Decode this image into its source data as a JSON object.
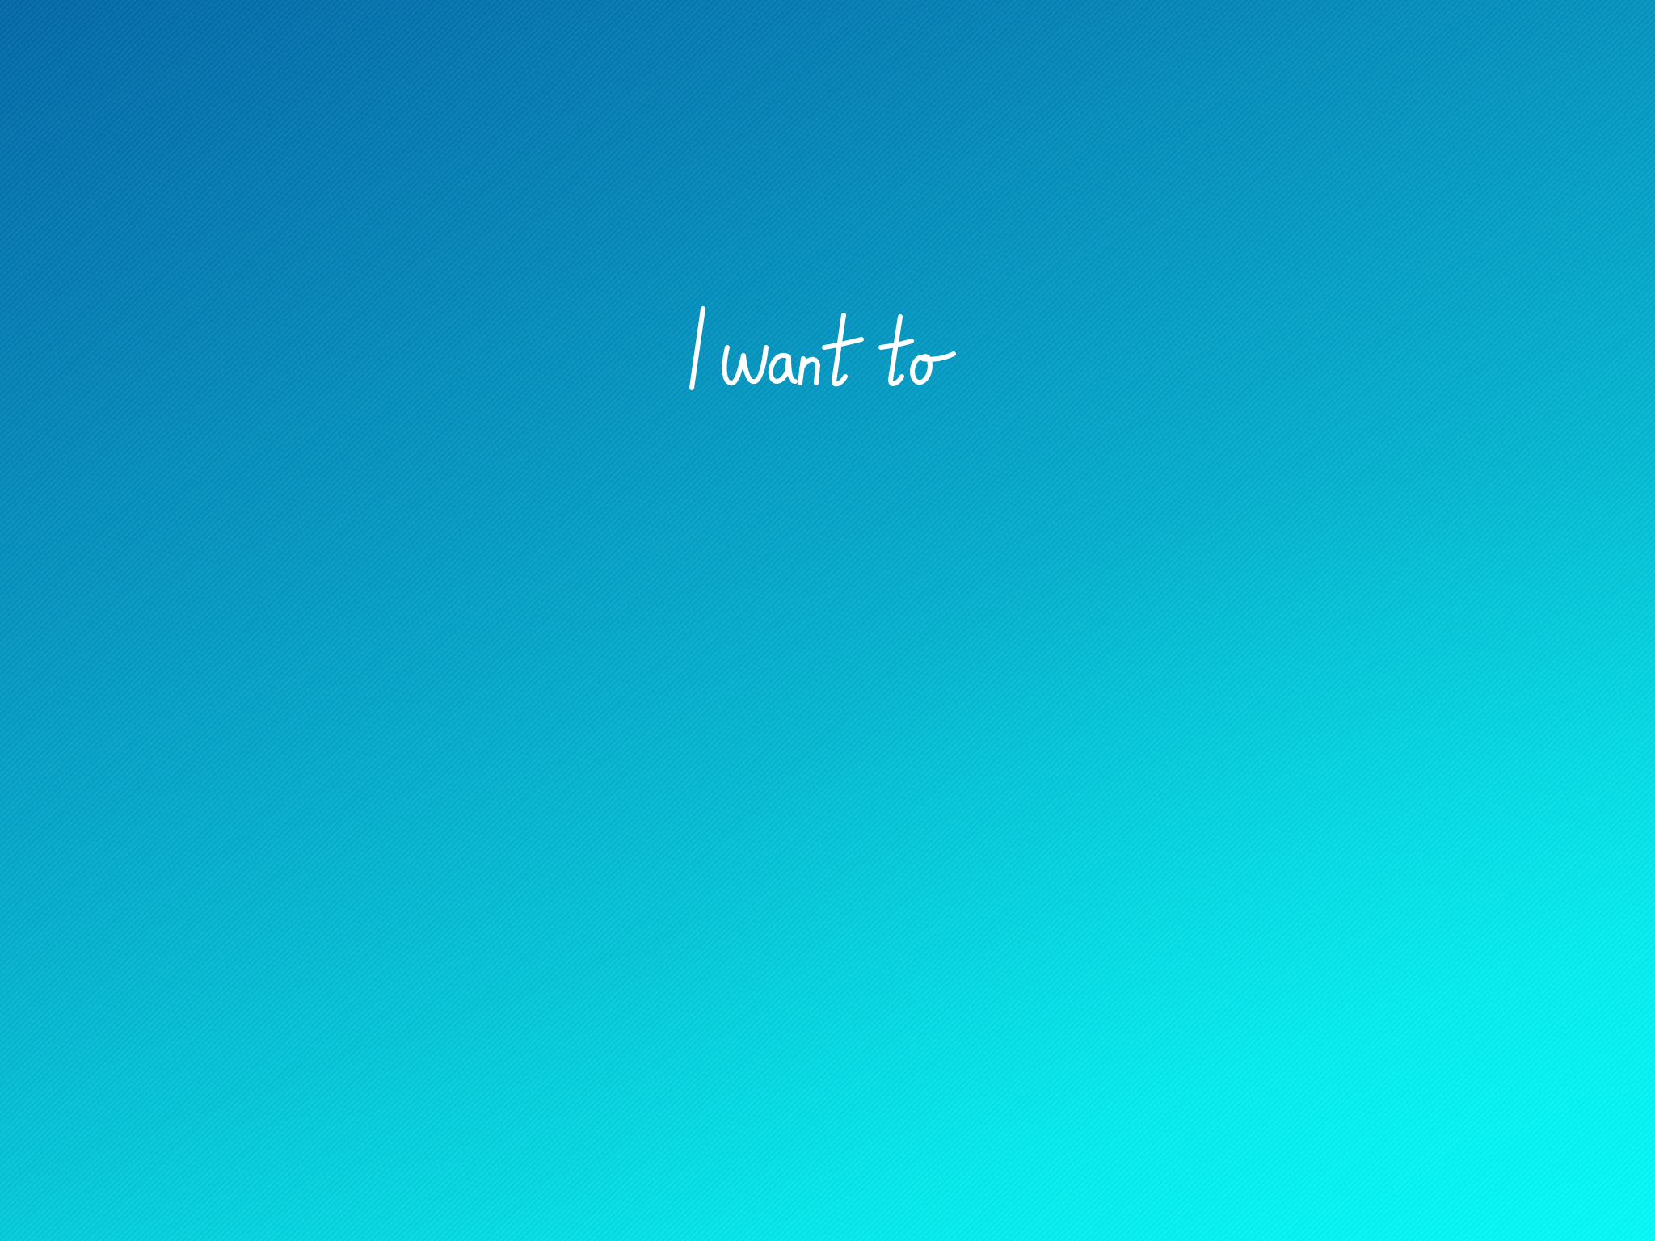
{
  "screen": {
    "heading": "I want to"
  },
  "colors": {
    "gradient_top_left": "#046aa9",
    "gradient_bottom_right": "#06f6f4",
    "heading_text": "#ffffff"
  }
}
